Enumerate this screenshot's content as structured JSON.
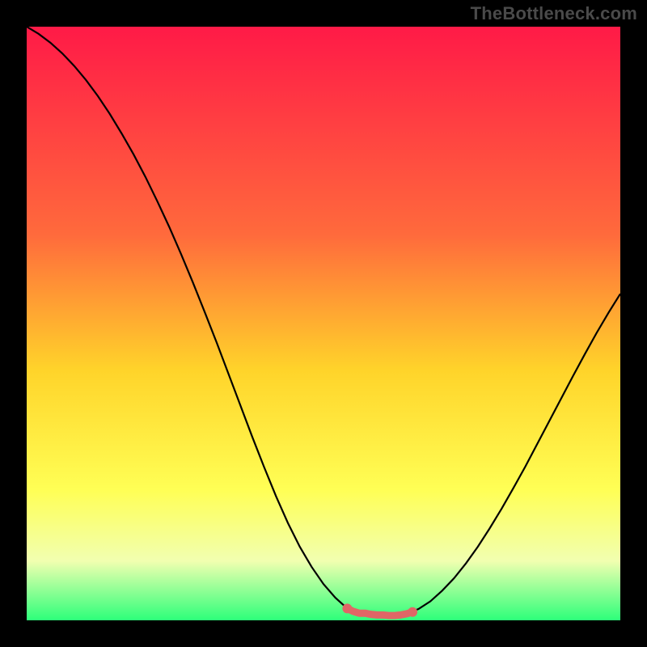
{
  "watermark": "TheBottleneck.com",
  "colors": {
    "grad_top": "#ff1a47",
    "grad_mid1": "#ff6a3c",
    "grad_mid2": "#ffd42a",
    "grad_mid3": "#ffff55",
    "grad_mid4": "#f1ffb0",
    "grad_bottom": "#2dff7a",
    "curve": "#000000",
    "marker": "#e06666",
    "background": "#000000"
  },
  "chart_data": {
    "type": "line",
    "title": "",
    "xlabel": "",
    "ylabel": "",
    "xlim": [
      0,
      100
    ],
    "ylim": [
      0,
      100
    ],
    "grid": false,
    "legend": false,
    "x": [
      0,
      2,
      4,
      6,
      8,
      10,
      12,
      14,
      16,
      18,
      20,
      22,
      24,
      26,
      28,
      30,
      32,
      34,
      36,
      38,
      40,
      42,
      44,
      46,
      48,
      50,
      52,
      54,
      55,
      56,
      57,
      58,
      60,
      62,
      64,
      66,
      68,
      70,
      72,
      74,
      76,
      78,
      80,
      82,
      84,
      86,
      88,
      90,
      92,
      94,
      96,
      98,
      100
    ],
    "series": [
      {
        "name": "bottleneck-curve",
        "values": [
          100,
          98.8,
          97.3,
          95.5,
          93.4,
          91.0,
          88.3,
          85.3,
          82.0,
          78.5,
          74.7,
          70.6,
          66.3,
          61.7,
          56.9,
          51.9,
          46.8,
          41.5,
          36.2,
          30.9,
          25.8,
          20.9,
          16.4,
          12.4,
          9.0,
          6.1,
          3.8,
          2.0,
          1.5,
          1.2,
          1.2,
          1.0,
          0.9,
          0.8,
          1.1,
          1.9,
          3.2,
          5.0,
          7.1,
          9.6,
          12.4,
          15.5,
          18.8,
          22.3,
          25.9,
          29.7,
          33.5,
          37.3,
          41.1,
          44.8,
          48.4,
          51.8,
          55.0
        ]
      }
    ],
    "markers": {
      "name": "optimal-range",
      "x": [
        54,
        55,
        56,
        57,
        58,
        59,
        60,
        61,
        62,
        63,
        64,
        65
      ],
      "y": [
        2.0,
        1.5,
        1.2,
        1.2,
        1.0,
        0.9,
        0.9,
        0.8,
        0.8,
        0.9,
        1.1,
        1.4
      ]
    },
    "gradient_stops": [
      {
        "offset": 0.0,
        "color": "#ff1a47"
      },
      {
        "offset": 0.35,
        "color": "#ff6a3c"
      },
      {
        "offset": 0.58,
        "color": "#ffd42a"
      },
      {
        "offset": 0.78,
        "color": "#ffff55"
      },
      {
        "offset": 0.9,
        "color": "#f1ffb0"
      },
      {
        "offset": 1.0,
        "color": "#2dff7a"
      }
    ]
  }
}
